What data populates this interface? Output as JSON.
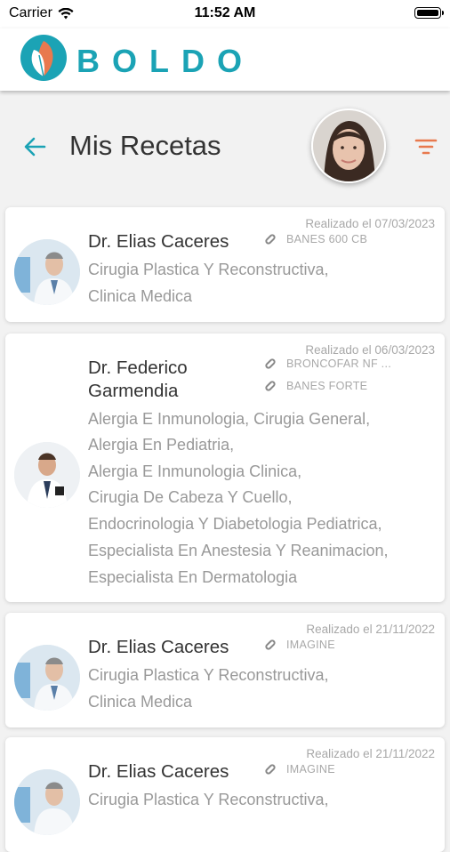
{
  "status_bar": {
    "carrier": "Carrier",
    "time": "11:52 AM"
  },
  "brand": {
    "name": "BOLDO"
  },
  "header": {
    "title": "Mis Recetas"
  },
  "colors": {
    "accent": "#1ba3b5",
    "filter": "#e8794e",
    "logo_orange": "#e8794e"
  },
  "prescriptions": [
    {
      "doctor": "Dr. Elias Caceres",
      "date": "Realizado el 07/03/2023",
      "medications": [
        "BANES 600 CB"
      ],
      "specialties": [
        "Cirugia Plastica Y Reconstructiva,",
        "Clinica Medica"
      ]
    },
    {
      "doctor": "Dr. Federico Garmendia",
      "doctor_lines": [
        "Dr. Federico",
        "Garmendia"
      ],
      "date": "Realizado el 06/03/2023",
      "medications": [
        "BRONCOFAR NF ...",
        "BANES FORTE"
      ],
      "specialties": [
        "Alergia E Inmunologia, Cirugia General,",
        "Alergia En Pediatria,",
        "Alergia E Inmunologia Clinica,",
        "Cirugia De Cabeza Y Cuello,",
        "Endocrinologia Y Diabetologia Pediatrica,",
        "Especialista En Anestesia Y Reanimacion,",
        "Especialista En Dermatologia"
      ]
    },
    {
      "doctor": "Dr. Elias Caceres",
      "date": "Realizado el 21/11/2022",
      "medications": [
        "IMAGINE"
      ],
      "specialties": [
        "Cirugia Plastica Y Reconstructiva,",
        "Clinica Medica"
      ]
    },
    {
      "doctor": "Dr. Elias Caceres",
      "date": "Realizado el 21/11/2022",
      "medications": [
        "IMAGINE"
      ],
      "specialties": [
        "Cirugia Plastica Y Reconstructiva,"
      ]
    }
  ]
}
